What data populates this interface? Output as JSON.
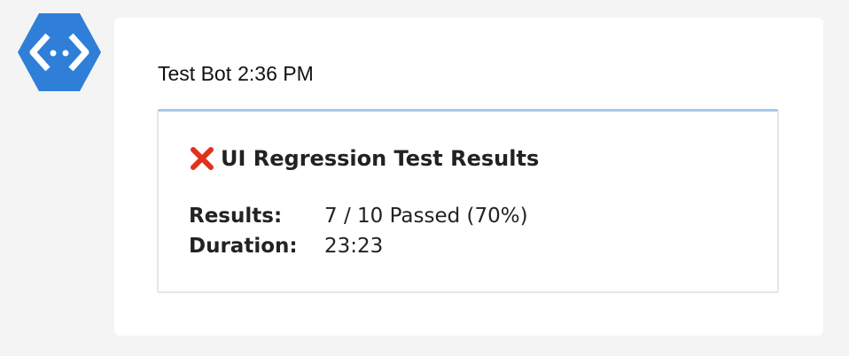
{
  "bot_avatar": {
    "icon": "azure-bot-service-icon",
    "bg_color": "#2f7ed8",
    "glyph_color": "#ffffff"
  },
  "message": {
    "sender": "Test Bot",
    "timestamp": "2:36 PM"
  },
  "card": {
    "status_icon": "red-x-icon",
    "status_color": "#e0301e",
    "title": "UI Regression Test Results",
    "facts": [
      {
        "key": "Results:",
        "value": "7 / 10 Passed (70%)"
      },
      {
        "key": "Duration:",
        "value": "23:23"
      }
    ]
  }
}
